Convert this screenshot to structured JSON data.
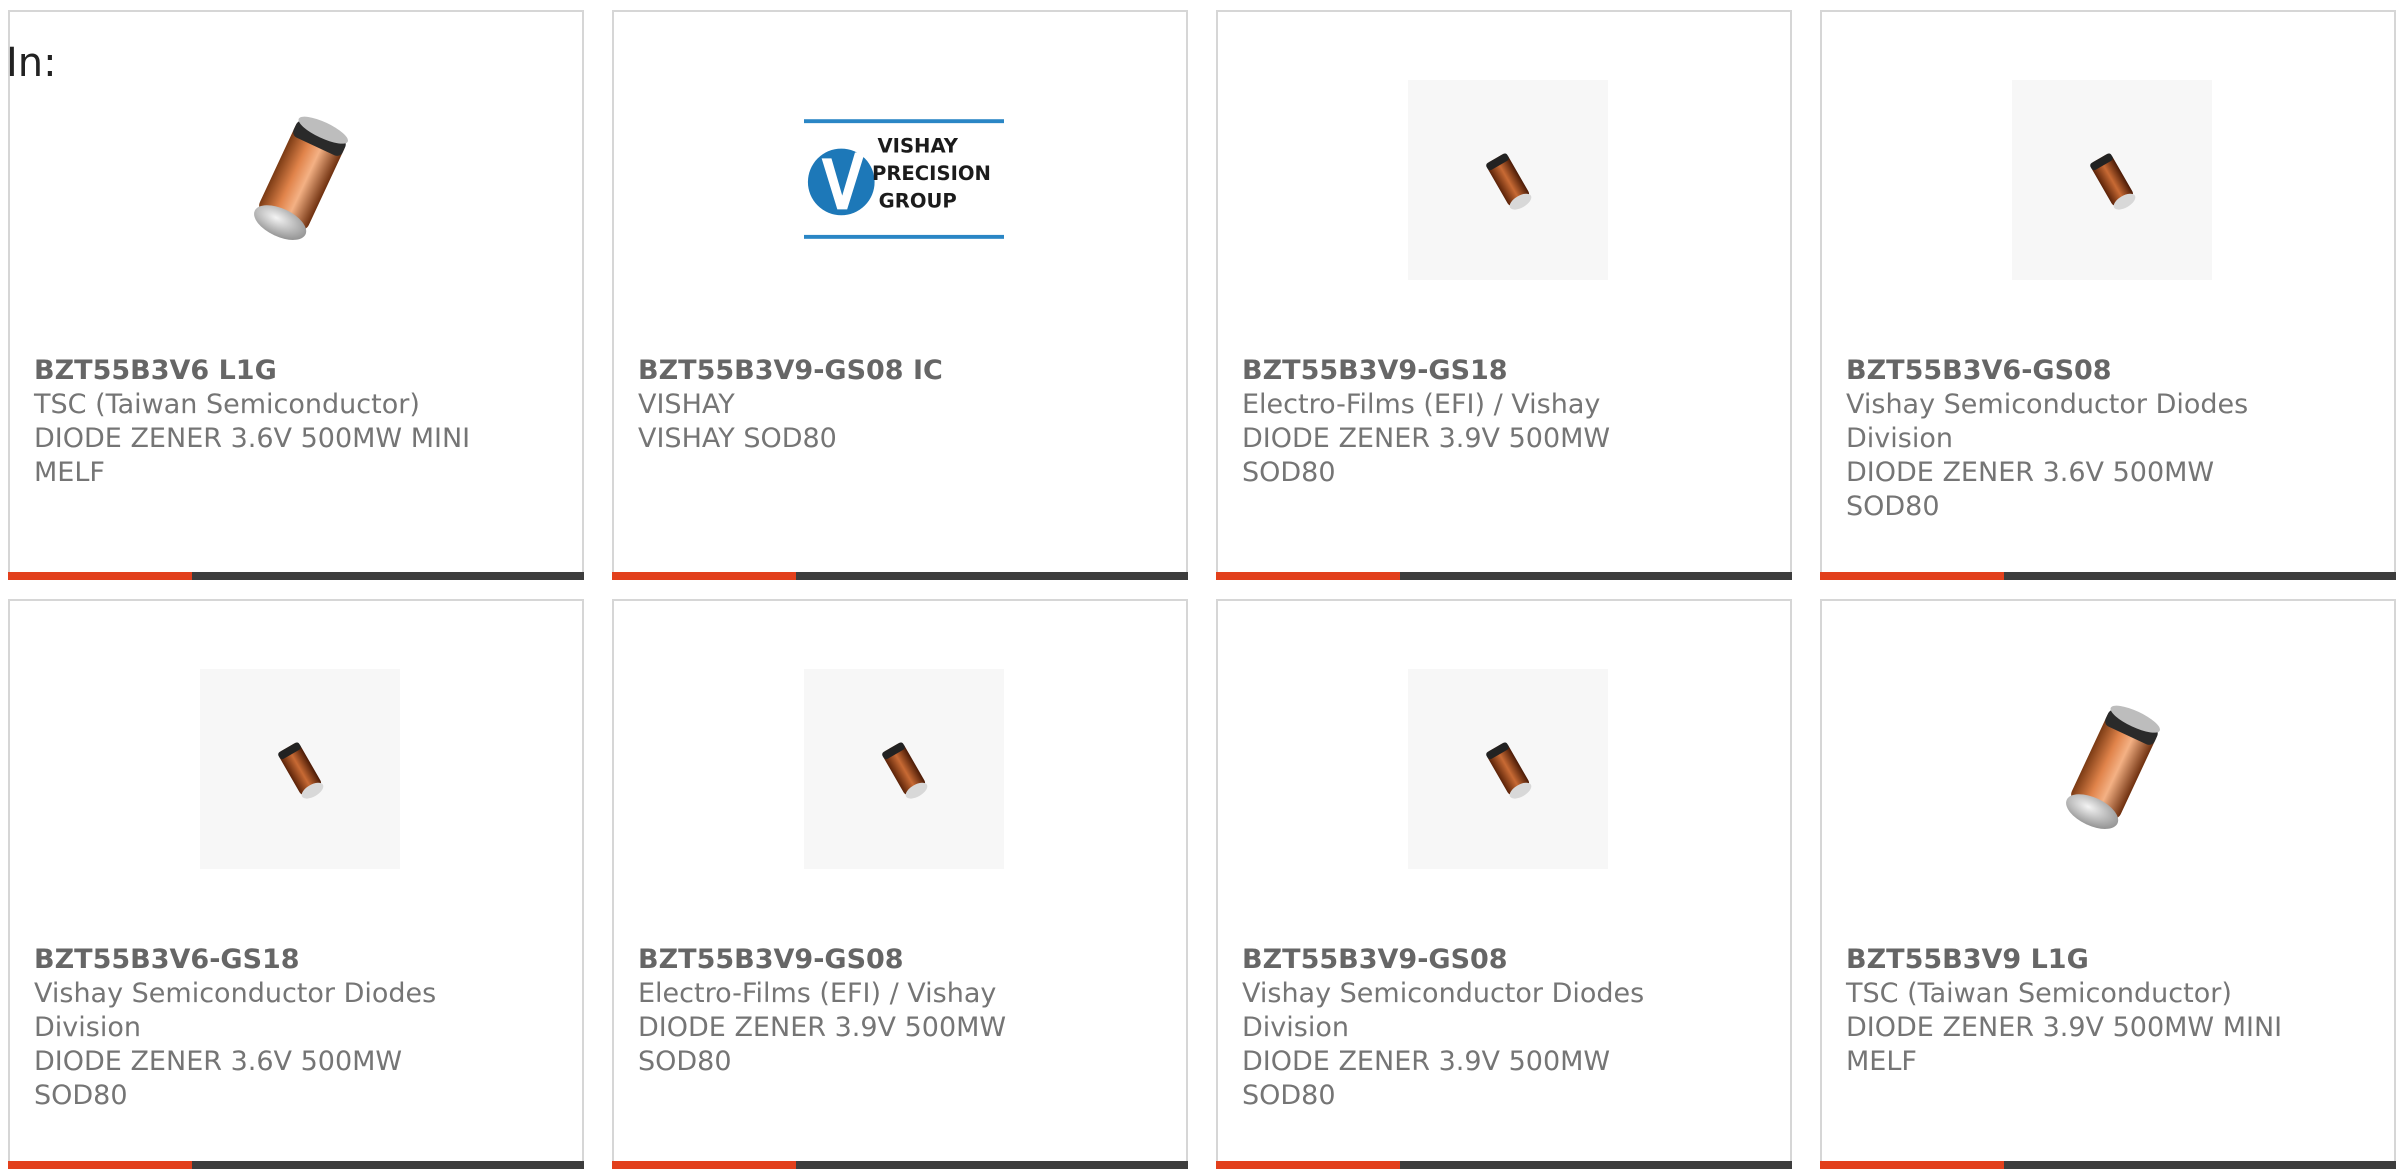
{
  "header": {
    "label": "In:"
  },
  "colors": {
    "accent": "#e2401c",
    "bar": "#3d3d3d",
    "border": "#d6d6d6",
    "text": "#757575"
  },
  "products": [
    {
      "part": "BZT55B3V6 L1G",
      "manufacturer": "TSC (Taiwan Semiconductor)",
      "description": "DIODE ZENER 3.6V 500MW MINI MELF",
      "image": "diode-melf-large-icon"
    },
    {
      "part": "BZT55B3V9-GS08 IC",
      "manufacturer": "VISHAY",
      "description": "VISHAY SOD80",
      "image": "vishay-precision-group-logo",
      "logo_lines": [
        "VISHAY",
        "PRECISION",
        "GROUP"
      ]
    },
    {
      "part": "BZT55B3V9-GS18",
      "manufacturer": "Electro-Films (EFI) / Vishay",
      "description": "DIODE ZENER 3.9V 500MW SOD80",
      "image": "diode-sod80-small-icon"
    },
    {
      "part": "BZT55B3V6-GS08",
      "manufacturer": "Vishay Semiconductor Diodes Division",
      "description": "DIODE ZENER 3.6V 500MW SOD80",
      "image": "diode-sod80-small-icon"
    },
    {
      "part": "BZT55B3V6-GS18",
      "manufacturer": "Vishay Semiconductor Diodes Division",
      "description": "DIODE ZENER 3.6V 500MW SOD80",
      "image": "diode-sod80-small-icon"
    },
    {
      "part": "BZT55B3V9-GS08",
      "manufacturer": "Electro-Films (EFI) / Vishay",
      "description": "DIODE ZENER 3.9V 500MW SOD80",
      "image": "diode-sod80-small-icon"
    },
    {
      "part": "BZT55B3V9-GS08",
      "manufacturer": "Vishay Semiconductor Diodes Division",
      "description": "DIODE ZENER 3.9V 500MW SOD80",
      "image": "diode-sod80-small-icon"
    },
    {
      "part": "BZT55B3V9 L1G",
      "manufacturer": "TSC (Taiwan Semiconductor)",
      "description": "DIODE ZENER 3.9V 500MW MINI MELF",
      "image": "diode-melf-large-icon"
    }
  ]
}
